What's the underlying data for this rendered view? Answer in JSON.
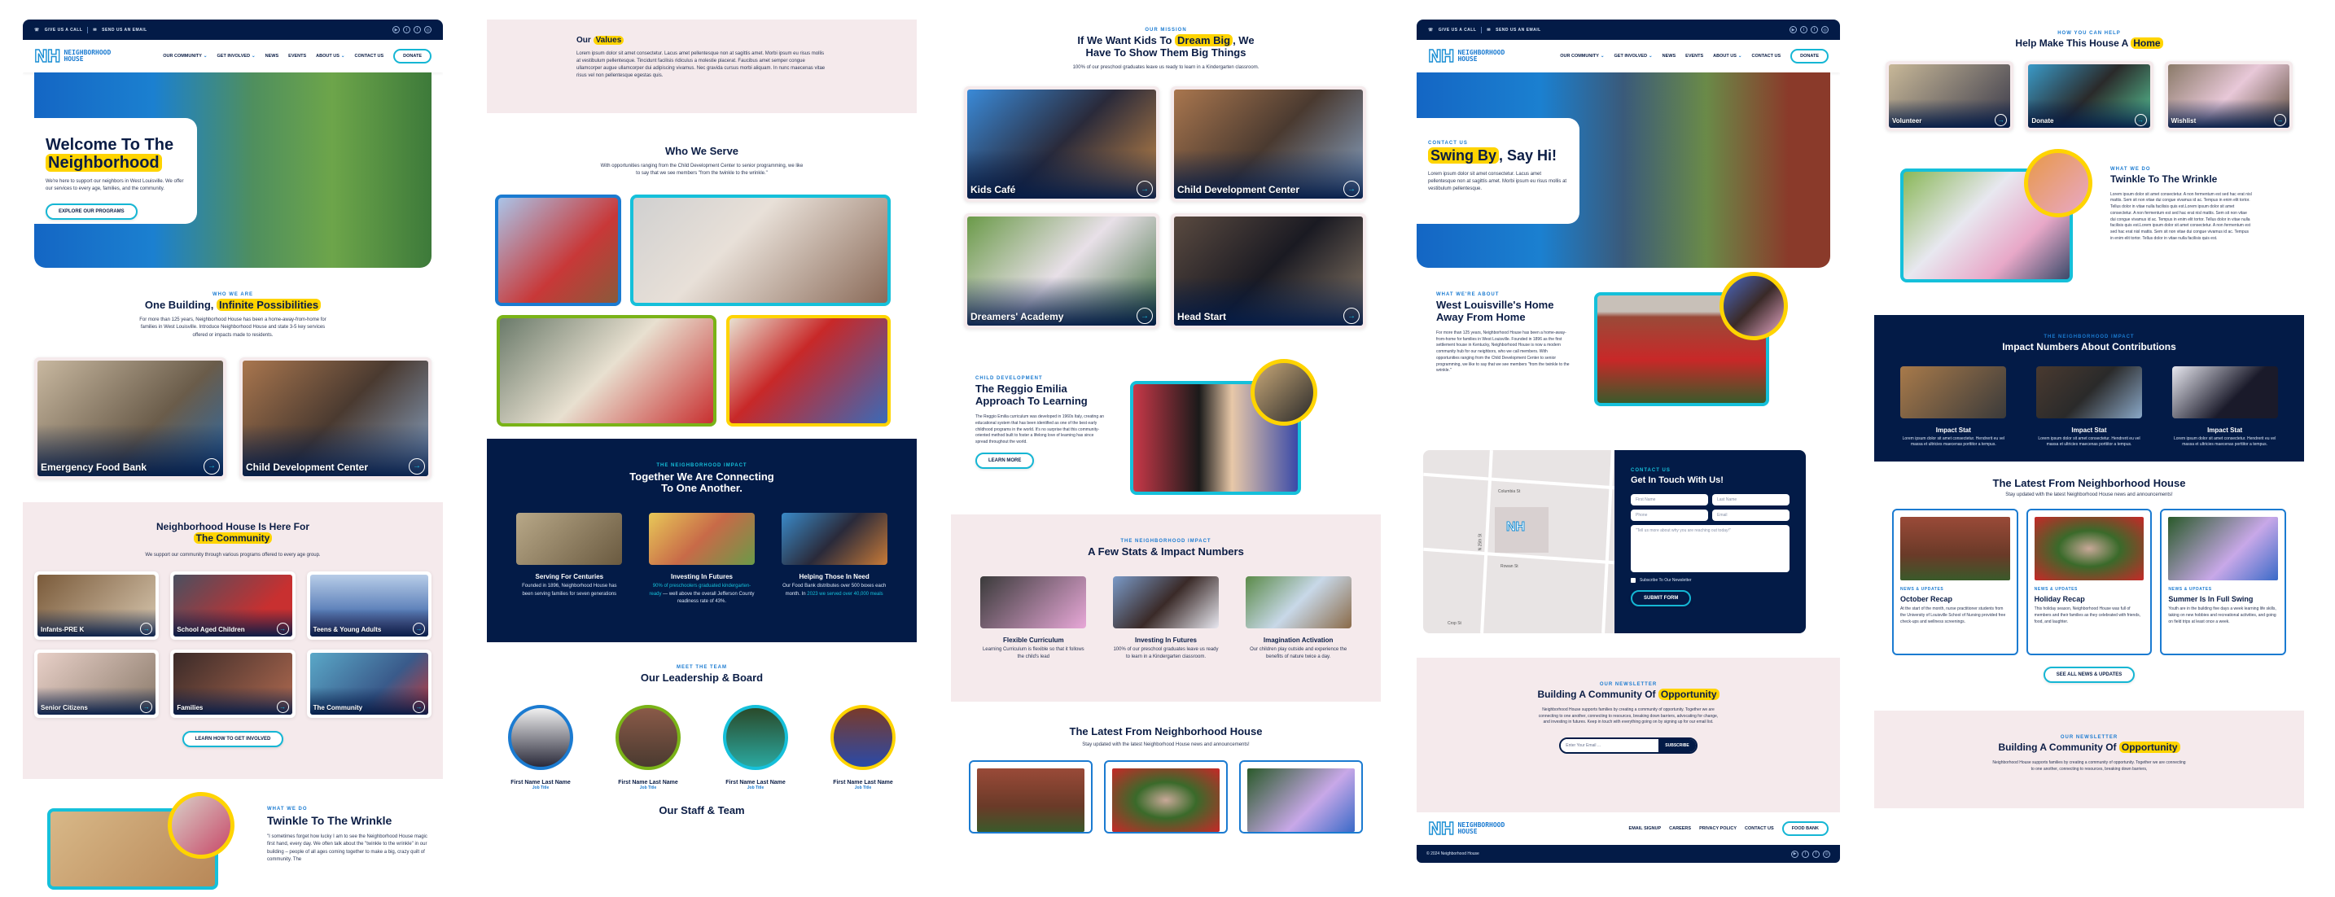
{
  "brand": {
    "logo_mark": "NH",
    "logo_line1": "NEIGHBORHOOD",
    "logo_line2": "HOUSE",
    "colors": {
      "navy": "#031b47",
      "blue": "#1b7bd1",
      "cyan": "#15c0da",
      "yellow": "#ffd400",
      "green": "#7ab317",
      "pink_bg": "#f5eaec"
    }
  },
  "topbar": {
    "call": "GIVE US A CALL",
    "email": "SEND US AN EMAIL",
    "social": [
      "youtube-icon",
      "twitter-icon",
      "facebook-icon",
      "instagram-icon"
    ]
  },
  "nav": {
    "items": [
      {
        "label": "OUR COMMUNITY",
        "dropdown": true
      },
      {
        "label": "GET INVOLVED",
        "dropdown": true
      },
      {
        "label": "NEWS",
        "dropdown": false
      },
      {
        "label": "EVENTS",
        "dropdown": false
      },
      {
        "label": "ABOUT US",
        "dropdown": true
      },
      {
        "label": "CONTACT US",
        "dropdown": false
      }
    ],
    "donate": "DONATE"
  },
  "home": {
    "hero": {
      "title_line1": "Welcome To The",
      "title_highlight": "Neighborhood",
      "body": "We're here to support our neighbors in West Louisville. We offer our services to every age, families, and the community.",
      "cta": "EXPLORE OUR PROGRAMS"
    },
    "who_we_are": {
      "eyebrow": "WHO WE ARE",
      "title_plain": "One Building, ",
      "title_highlight": "Infinite Possibilities",
      "body": "For more than 125 years, Neighborhood House has been a home-away-from-home for families in West Louisville. Introduce Neighborhood House and state 3-5 key services offered or impacts made to residents.",
      "tiles": [
        "Emergency Food Bank",
        "Child Development Center"
      ]
    },
    "community": {
      "title_line1": "Neighborhood House Is Here For",
      "title_highlight": "The Community",
      "body": "We support our community through various programs offered to every age group.",
      "tiles": [
        "Infants-PRE K",
        "School Aged Children",
        "Teens & Young Adults",
        "Senior Citizens",
        "Families",
        "The Community"
      ],
      "cta": "LEARN HOW TO GET INVOLVED"
    },
    "twinkle": {
      "eyebrow": "WHAT WE DO",
      "title": "Twinkle To The Wrinkle",
      "body": "\"I sometimes forget how lucky I am to see the Neighborhood House magic first hand, every day. We often talk about the \"twinkle to the wrinkle\" in our building – people of all ages coming together to make a big, crazy quilt of community. The"
    }
  },
  "about": {
    "values": {
      "title_plain": "Our ",
      "title_highlight": "Values",
      "body": "Lorem ipsum dolor sit amet consectetur. Lacus amet pellentesque non at sagittis amet. Morbi ipsum eu risus mollis at vestibulum pellentesque. Tincidunt facilisis ridiculus a molestie placerat. Faucibus amet semper congue ullamcorper augue ullamcorper dui adipiscing vivamus. Nec gravida cursus morbi aliquam. In nunc maecenas vitae risus vel non pellentesque egestas quis."
    },
    "who_we_serve": {
      "title": "Who We Serve",
      "body": "With opportunities ranging from the Child Development Center to senior programming, we like to say that we see members \"from the twinkle to the wrinkle.\""
    },
    "impact": {
      "eyebrow": "THE NEIGHBORHOOD IMPACT",
      "title_line1": "Together We Are Connecting",
      "title_line2": "To One Another.",
      "items": [
        {
          "title": "Serving For Centuries",
          "body": "Founded in 1896, Neighborhood House has been serving families for seven generations"
        },
        {
          "title": "Investing In Futures",
          "highlight": "90% of preschoolers graduated kindergarten-ready",
          "body": " — well above the overall Jefferson County readiness rate of 43%."
        },
        {
          "title": "Helping Those In Need",
          "body": "Our Food Bank distributes over 500 boxes each month. In ",
          "highlight": "2023 we served over 40,000 meals"
        }
      ]
    },
    "team": {
      "eyebrow": "MEET THE TEAM",
      "title": "Our Leadership & Board",
      "members": [
        {
          "name": "First Name Last Name",
          "title": "Job Title"
        },
        {
          "name": "First Name Last Name",
          "title": "Job Title"
        },
        {
          "name": "First Name Last Name",
          "title": "Job Title"
        },
        {
          "name": "First Name Last Name",
          "title": "Job Title"
        }
      ],
      "staff_title": "Our Staff & Team"
    }
  },
  "programs": {
    "mission": {
      "eyebrow": "OUR MISSION",
      "title_pre": "If We Want Kids To ",
      "title_highlight": "Dream Big",
      "title_post": ", We Have To Show Them Big Things",
      "body": "100% of our preschool graduates leave us ready to learn in a Kindergarten classroom.",
      "tiles": [
        "Kids Café",
        "Child Development Center",
        "Dreamers' Academy",
        "Head Start"
      ]
    },
    "reggio": {
      "eyebrow": "CHILD DEVELOPMENT",
      "title": "The Reggio Emilia Approach To Learning",
      "body": "The Reggio Emilia curriculum was developed in 1960s Italy, creating an educational system that has been identified as one of the best early childhood programs in the world. It's no surprise that this community-oriented method built to foster a lifelong love of learning has since spread throughout the world.",
      "cta": "LEARN MORE"
    },
    "stats": {
      "eyebrow": "THE NEIGHBORHOOD IMPACT",
      "title": "A Few Stats & Impact Numbers",
      "items": [
        {
          "title": "Flexible Curriculum",
          "body": "Learning Curriculum is flexible so that it follows the child's lead"
        },
        {
          "title": "Investing In Futures",
          "body": "100% of our preschool graduates leave us ready to learn in a Kindergarten classroom."
        },
        {
          "title": "Imagination Activation",
          "body": "Our children play outside and experience the benefits of nature twice a day."
        }
      ]
    },
    "latest": {
      "title": "The Latest From Neighborhood House",
      "body": "Stay updated with the latest Neighborhood House news and announcements!"
    }
  },
  "contact": {
    "hero": {
      "eyebrow": "CONTACT US",
      "title_highlight": "Swing By",
      "title_post": ", Say Hi!",
      "body": "Lorem ipsum dolor sit amet consectetur. Lacus amet pellentesque non at sagittis amet. Morbi ipsum eu risus mollis at vestibulum pellentesque."
    },
    "about": {
      "eyebrow": "WHAT WE'RE ABOUT",
      "title": "West Louisville's Home Away From Home",
      "body": "For more than 125 years, Neighborhood House has been a home-away-from-home for families in West Louisville. Founded in 1896 as the first settlement house in Kentucky, Neighborhood House is now a modern community hub for our neighbors, who we call members. With opportunities ranging from the Child Development Center to senior programming, we like to say that we see members \"from the twinkle to the wrinkle.\""
    },
    "map": {
      "streets": [
        "Columbia St",
        "Columbia St",
        "Rowan St",
        "N 25th St",
        "N 26th St",
        "Crop St"
      ]
    },
    "form": {
      "eyebrow": "CONTACT US",
      "title": "Get In Touch With Us!",
      "first_name": "First Name",
      "last_name": "Last Name",
      "phone": "Phone",
      "email": "Email",
      "message": "\"Tell us more about why you are reaching out today!\"",
      "subscribe": "Subscribe To Our Newsletter",
      "subscribe_checked": false,
      "submit": "SUBMIT FORM"
    },
    "newsletter": {
      "eyebrow": "OUR NEWSLETTER",
      "title_plain": "Building A Community Of ",
      "title_highlight": "Opportunity",
      "body": "Neighborhood House supports families by creating a community of opportunity. Together we are connecting to one another, connecting to resources, breaking down barriers, advocating for change, and investing in futures. Keep in touch with everything going on by signing up for our email list.",
      "placeholder": "Enter Your Email ...",
      "button": "SUBSCRIBE"
    },
    "footer": {
      "links": [
        "EMAIL SIGNUP",
        "CAREERS",
        "PRIVACY POLICY",
        "CONTACT US"
      ],
      "button": "FOOD BANK",
      "copyright": "© 2024 Neighborhood House"
    }
  },
  "involved": {
    "help": {
      "eyebrow": "HOW YOU CAN HELP",
      "title_plain": "Help Make This House A ",
      "title_highlight": "Home",
      "tiles": [
        "Volunteer",
        "Donate",
        "Wishlist"
      ]
    },
    "twinkle": {
      "eyebrow": "WHAT WE DO",
      "title": "Twinkle To The Wrinkle",
      "body": "Lorem ipsum dolor sit amet consectetur. A non fermentum est sed hac erat nisl mattis. Sem sit non vitae dui congue vivamus id ac. Tempus in enim elit tortor. Tellus dolor in vitae nulla facilisis quis est.Lorem ipsum dolor sit amet consectetur. A non fermentum est sed hac erat nisl mattis. Sem sit non vitae dui congue vivamus id ac. Tempus in enim elit tortor. Tellus dolor in vitae nulla facilisis quis est.Lorem ipsum dolor sit amet consectetur. A non fermentum est sed hac erat nisl mattis. Sem sit non vitae dui congue vivamus id ac. Tempus in enim elit tortor. Tellus dolor in vitae nulla facilisis quis est."
    },
    "impact": {
      "eyebrow": "THE NEIGHBORHOOD IMPACT",
      "title": "Impact Numbers About Contributions",
      "items": [
        {
          "title": "Impact Stat",
          "body": "Lorem ipsum dolor sit amet consectetur. Hendrerit eu vel massa et ultricies maecenas porttitor a tempus."
        },
        {
          "title": "Impact Stat",
          "body": "Lorem ipsum dolor sit amet consectetur. Hendrerit eu vel massa et ultricies maecenas porttitor a tempus."
        },
        {
          "title": "Impact Stat",
          "body": "Lorem ipsum dolor sit amet consectetur. Hendrerit eu vel massa et ultricies maecenas porttitor a tempus."
        }
      ]
    },
    "latest": {
      "title": "The Latest From Neighborhood House",
      "body": "Stay updated with the latest Neighborhood House news and announcements!",
      "cards": [
        {
          "category": "NEWS & UPDATES",
          "title": "October Recap",
          "body": "At the start of the month, nurse practitioner students from the University of Louisville School of Nursing provided free check-ups and wellness screenings."
        },
        {
          "category": "NEWS & UPDATES",
          "title": "Holiday Recap",
          "body": "This holiday season, Neighborhood House was full of members and their families as they celebrated with friends, food, and laughter."
        },
        {
          "category": "NEWS & UPDATES",
          "title": "Summer Is In Full Swing",
          "body": "Youth are in the building five days a week learning life skills, taking on new hobbies and recreational activities, and going on field trips at least once a week."
        }
      ],
      "cta": "SEE ALL NEWS & UPDATES"
    },
    "newsletter": {
      "eyebrow": "OUR NEWSLETTER",
      "title_plain": "Building A Community Of ",
      "title_highlight": "Opportunity",
      "body": "Neighborhood House supports families by creating a community of opportunity. Together we are connecting to one another, connecting to resources, breaking down barriers,"
    }
  }
}
